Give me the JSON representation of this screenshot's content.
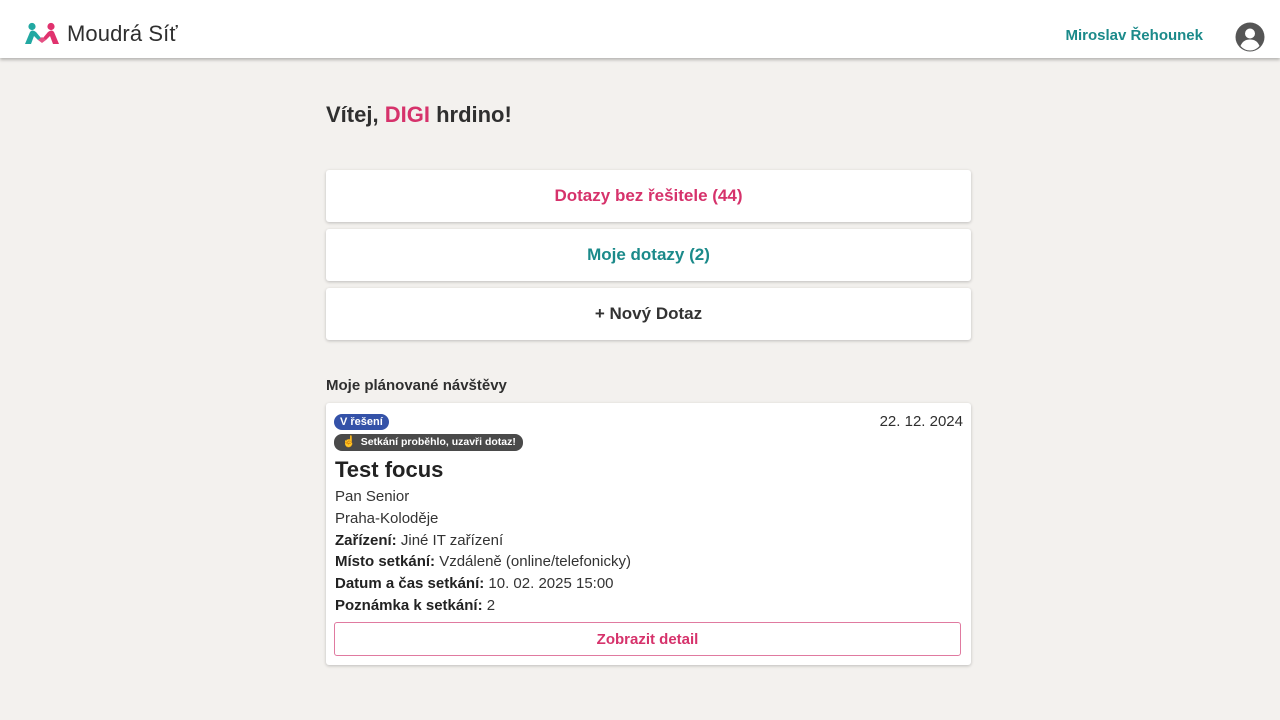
{
  "header": {
    "app_name": "Moudrá Síť",
    "user_name": "Miroslav Řehounek"
  },
  "welcome": {
    "prefix": "Vítej,",
    "accent": "DIGI",
    "suffix": "hrdino!"
  },
  "actions": {
    "unassigned": "Dotazy bez řešitele (44)",
    "mine": "Moje dotazy (2)",
    "new": "+ Nový Dotaz"
  },
  "planned": {
    "section_title": "Moje plánované návštěvy",
    "visit": {
      "state_badge": "V řešení",
      "done_badge": "Setkání proběhlo, uzavři dotaz!",
      "date": "22. 12. 2024",
      "title": "Test focus",
      "senior": "Pan Senior",
      "location": "Praha-Koloděje",
      "device_label": "Zařízení:",
      "device_value": "Jiné IT zařízení",
      "place_label": "Místo setkání:",
      "place_value": "Vzdáleně (online/telefonicky)",
      "datetime_label": "Datum a čas setkání:",
      "datetime_value": "10. 02. 2025 15:00",
      "note_label": "Poznámka k setkání:",
      "note_value": "2",
      "detail_button": "Zobrazit detail"
    }
  },
  "colors": {
    "accent_pink": "#d6326b",
    "accent_teal": "#1b8a8a",
    "badge_blue": "#3452a8",
    "background": "#f3f1ee"
  }
}
